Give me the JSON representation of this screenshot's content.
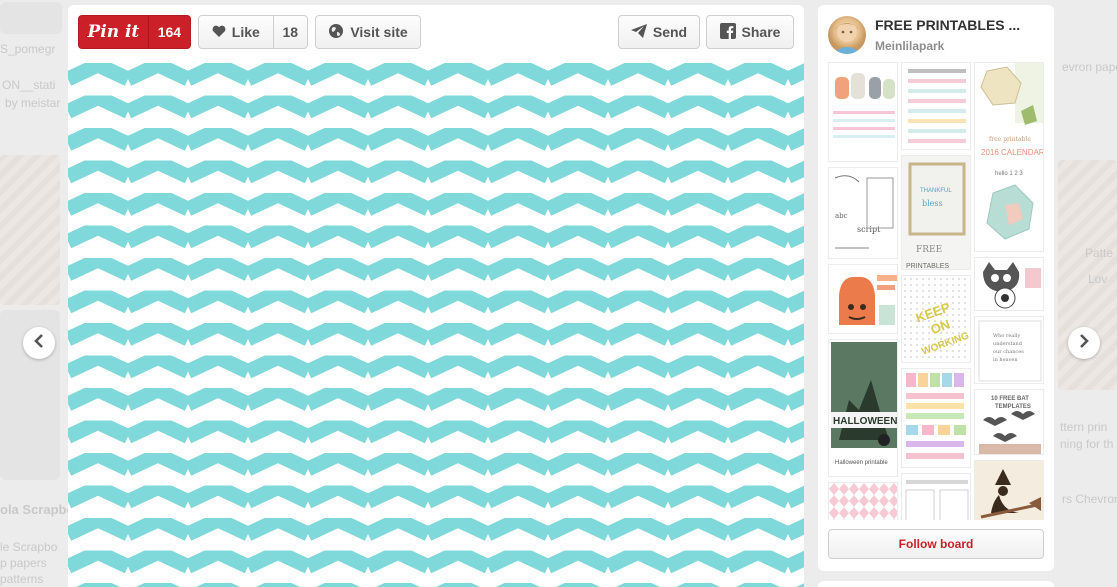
{
  "toolbar": {
    "pinit_label": "Pin it",
    "pinit_count": "164",
    "like_label": "Like",
    "like_count": "18",
    "visit_label": "Visit site",
    "send_label": "Send",
    "share_label": "Share"
  },
  "pin": {
    "image_icon": "chevron-pattern",
    "pattern_color": "#7fd8d9"
  },
  "board": {
    "title": "FREE PRINTABLES ...",
    "owner": "Meinlilapark",
    "follow_label": "Follow board"
  },
  "navigation": {
    "prev_icon": "chevron-left-icon",
    "next_icon": "chevron-right-icon"
  },
  "background": {
    "fragments": [
      "S_pomegr",
      "ON__stati",
      "by meistar",
      "ola Scrapbo",
      "le Scrapbo",
      "p papers",
      "patterns",
      "evron pape",
      "Patte",
      "Lov",
      "ttern prin",
      "ning for th",
      "rs Chevron"
    ]
  },
  "colors": {
    "brand_red": "#cb2027",
    "teal": "#7fd8d9"
  }
}
